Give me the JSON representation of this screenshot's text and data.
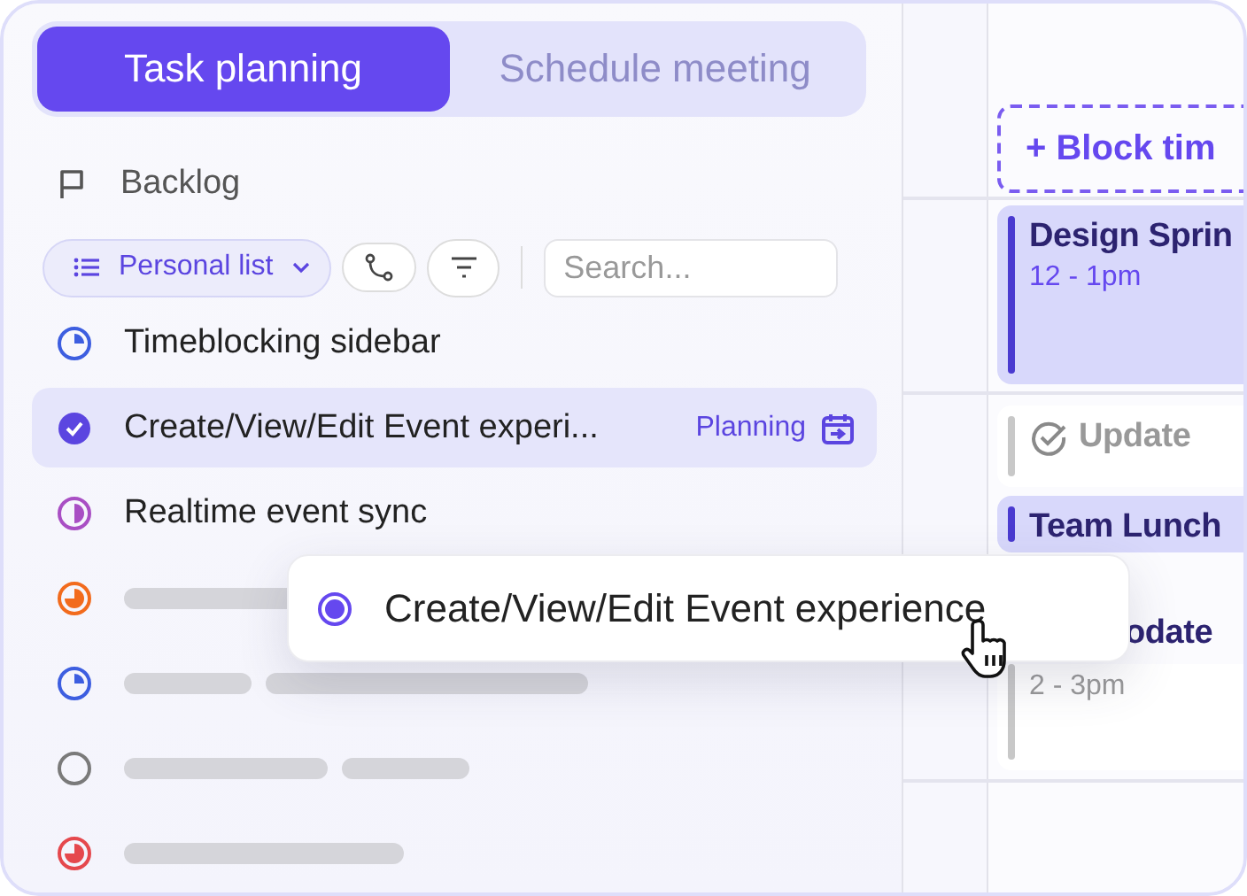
{
  "tabs": [
    {
      "label": "Task planning",
      "selected": true
    },
    {
      "label": "Schedule meeting",
      "selected": false
    }
  ],
  "backlog": {
    "label": "Backlog"
  },
  "toolbar": {
    "list_button": "Personal list",
    "search": {
      "placeholder": "Search..."
    }
  },
  "tasks": [
    {
      "kind": "task",
      "title": "Timeblocking sidebar",
      "color": "#3d5ee0",
      "done": false,
      "selected": false
    },
    {
      "kind": "task",
      "title": "Create/View/Edit Event experi...",
      "color": "#5b45e0",
      "done": true,
      "selected": true,
      "tag": "Planning"
    },
    {
      "kind": "task",
      "title": "Realtime event sync",
      "color": "#a94fc4",
      "done": false,
      "selected": false
    },
    {
      "kind": "placeholder",
      "color": "#f26b1d",
      "done": false,
      "selected": false
    },
    {
      "kind": "placeholder",
      "color": "#3d5ee0",
      "done": false,
      "selected": false
    },
    {
      "kind": "placeholder",
      "color": "#7a7a7a",
      "done": false,
      "selected": false
    },
    {
      "kind": "placeholder",
      "color": "#e5484d",
      "done": false,
      "selected": false
    }
  ],
  "calendar": {
    "events": [
      {
        "kind": "add",
        "title": "+ Block tim"
      },
      {
        "kind": "event",
        "title": "Design Sprin",
        "time": "12 - 1pm"
      },
      {
        "kind": "task",
        "title": "Update"
      },
      {
        "kind": "event",
        "title": "Team Lunch"
      },
      {
        "kind": "task",
        "title": "odate",
        "time": "2 - 3pm"
      }
    ]
  },
  "drag_card": {
    "title": "Create/View/Edit Event experience"
  }
}
